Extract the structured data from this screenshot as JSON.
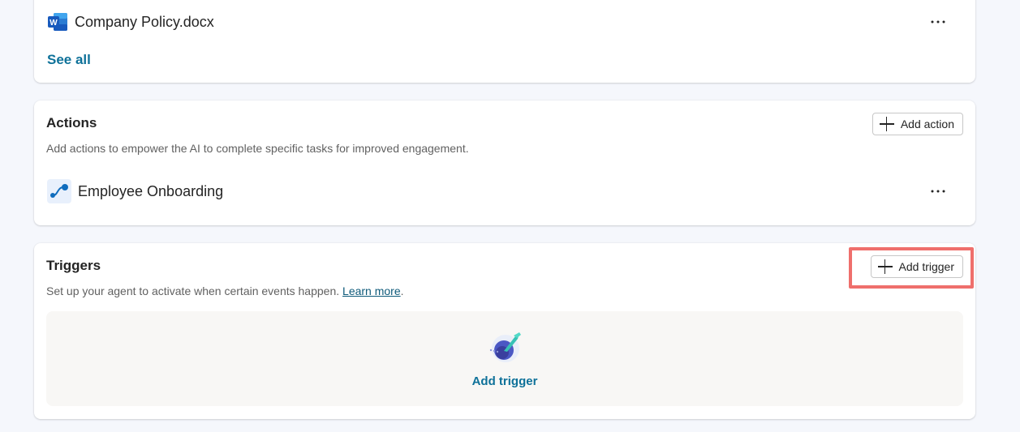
{
  "knowledge": {
    "items": [
      {
        "name": "Company Policy.docx",
        "icon": "word-doc-icon",
        "more_label": "···"
      }
    ],
    "see_all_label": "See all"
  },
  "actions": {
    "title": "Actions",
    "description": "Add actions to empower the AI to complete specific tasks for improved engagement.",
    "add_button_label": "Add action",
    "items": [
      {
        "name": "Employee Onboarding",
        "icon": "flow-icon",
        "more_label": "···"
      }
    ]
  },
  "triggers": {
    "title": "Triggers",
    "description": "Set up your agent to activate when certain events happen.",
    "learn_more_label": "Learn more",
    "description_suffix": ".",
    "add_button_label": "Add trigger",
    "empty_state": {
      "icon": "trigger-bolt-icon",
      "link_label": "Add trigger"
    }
  },
  "colors": {
    "accent_link": "#0e7199",
    "highlight": "#ef6f6c",
    "background": "#f5f7fc"
  }
}
